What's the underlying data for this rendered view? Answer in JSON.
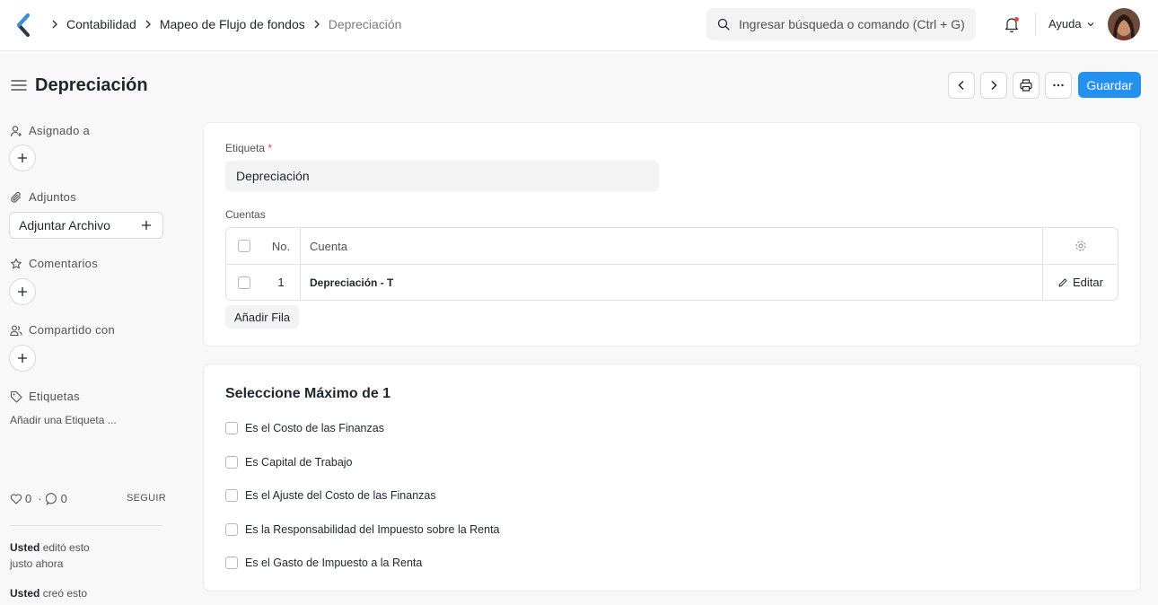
{
  "breadcrumb": {
    "items": [
      "Contabilidad",
      "Mapeo de Flujo de fondos"
    ],
    "current": "Depreciación"
  },
  "search": {
    "placeholder": "Ingresar búsqueda o comando (Ctrl + G)"
  },
  "navbar": {
    "help_label": "Ayuda"
  },
  "page": {
    "title": "Depreciación",
    "save_label": "Guardar"
  },
  "sidebar": {
    "assigned_label": "Asignado a",
    "attachments_label": "Adjuntos",
    "attach_file_label": "Adjuntar Archivo",
    "comments_label": "Comentarios",
    "shared_label": "Compartido con",
    "tags_label": "Etiquetas",
    "add_tag_label": "Añadir una Etiqueta ...",
    "likes": "0",
    "comment_count": "0",
    "follow_label": "SEGUIR",
    "activity": [
      {
        "user": "Usted",
        "action": "editó esto",
        "time": "justo ahora"
      },
      {
        "user": "Usted",
        "action": "creó esto"
      }
    ]
  },
  "form": {
    "label_field": {
      "label": "Etiqueta",
      "required_mark": "*",
      "value": "Depreciación"
    },
    "accounts": {
      "label": "Cuentas",
      "columns": {
        "no": "No.",
        "account": "Cuenta"
      },
      "rows": [
        {
          "no": "1",
          "account": "Depreciación - T",
          "edit_label": "Editar"
        }
      ],
      "add_row_label": "Añadir Fila"
    }
  },
  "options": {
    "title": "Seleccione Máximo de 1",
    "items": [
      "Es el Costo de las Finanzas",
      "Es Capital de Trabajo",
      "Es el Ajuste del Costo de las Finanzas",
      "Es la Responsabilidad del Impuesto sobre la Renta",
      "Es el Gasto de Impuesto a la Renta"
    ]
  },
  "colors": {
    "primary": "#2490ef",
    "required": "#e24c4c",
    "notification": "#e24c4c"
  }
}
